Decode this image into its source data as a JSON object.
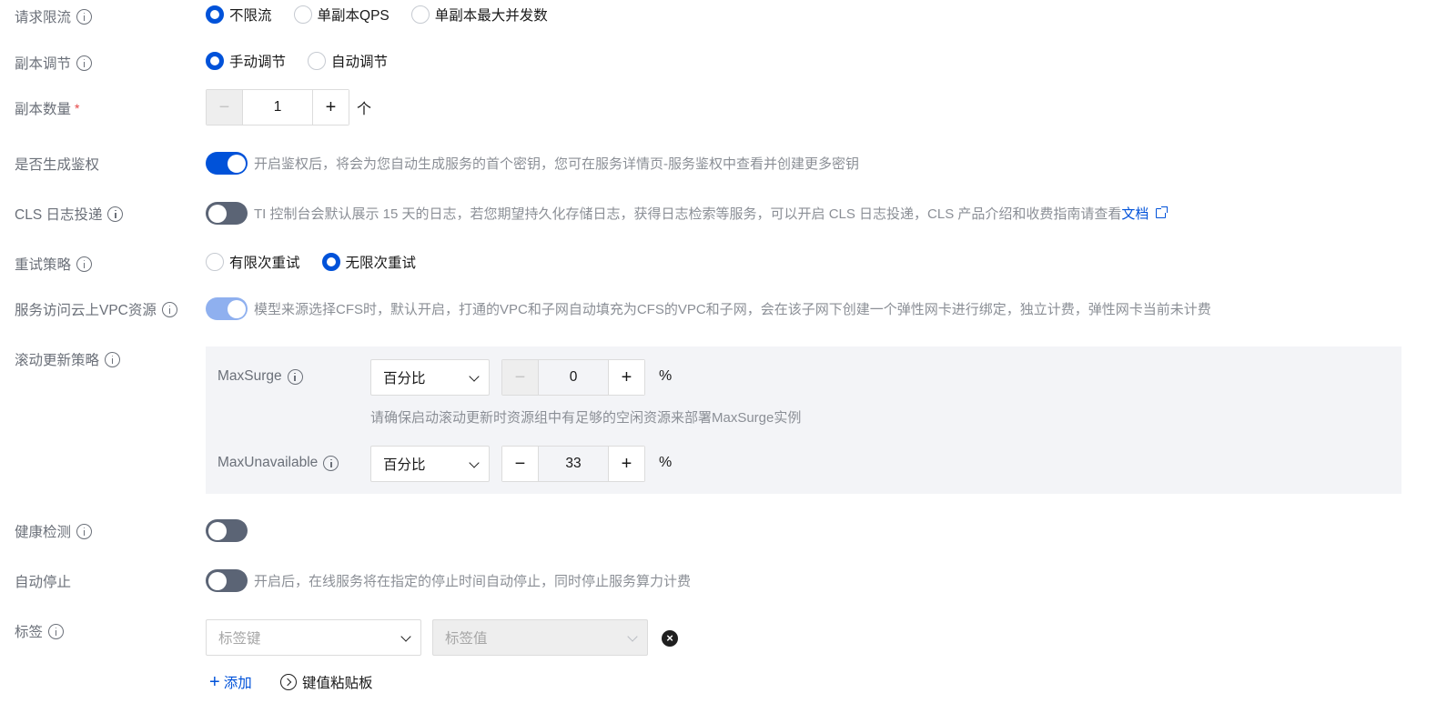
{
  "rate_limit": {
    "label": "请求限流",
    "options": [
      "不限流",
      "单副本QPS",
      "单副本最大并发数"
    ],
    "selected": "不限流"
  },
  "replica_adjust": {
    "label": "副本调节",
    "options": [
      "手动调节",
      "自动调节"
    ],
    "selected": "手动调节"
  },
  "replica_count": {
    "label": "副本数量",
    "required_mark": "*",
    "minus": "−",
    "value": "1",
    "plus": "+",
    "unit": "个"
  },
  "auth": {
    "label": "是否生成鉴权",
    "enabled": true,
    "hint": "开启鉴权后，将会为您自动生成服务的首个密钥，您可在服务详情页-服务鉴权中查看并创建更多密钥"
  },
  "cls": {
    "label": "CLS 日志投递",
    "enabled": false,
    "hint": "TI 控制台会默认展示 15 天的日志，若您期望持久化存储日志，获得日志检索等服务，可以开启 CLS 日志投递，CLS 产品介绍和收费指南请查看",
    "link": "文档"
  },
  "retry": {
    "label": "重试策略",
    "options": [
      "有限次重试",
      "无限次重试"
    ],
    "selected": "无限次重试"
  },
  "vpc": {
    "label": "服务访问云上VPC资源",
    "enabled": true,
    "disabled": true,
    "hint": "模型来源选择CFS时，默认开启，打通的VPC和子网自动填充为CFS的VPC和子网，会在该子网下创建一个弹性网卡进行绑定，独立计费，弹性网卡当前未计费"
  },
  "rolling_update": {
    "label": "滚动更新策略",
    "max_surge": {
      "label": "MaxSurge",
      "mode": "百分比",
      "minus": "−",
      "value": "0",
      "plus": "+",
      "unit": "%",
      "hint": "请确保启动滚动更新时资源组中有足够的空闲资源来部署MaxSurge实例"
    },
    "max_unavailable": {
      "label": "MaxUnavailable",
      "mode": "百分比",
      "minus": "−",
      "value": "33",
      "plus": "+",
      "unit": "%"
    }
  },
  "health_check": {
    "label": "健康检测",
    "enabled": false
  },
  "auto_stop": {
    "label": "自动停止",
    "enabled": false,
    "hint": "开启后，在线服务将在指定的停止时间自动停止，同时停止服务算力计费"
  },
  "tags": {
    "label": "标签",
    "key_placeholder": "标签键",
    "value_placeholder": "标签值",
    "add": "添加",
    "add_icon": "+",
    "paste": "键值粘贴板",
    "clear_icon": "×"
  },
  "colors": {
    "primary": "#0052d9",
    "switch_off": "#5b6475",
    "switch_on_disabled": "#8fb0ef",
    "panel_bg": "#f3f4f7"
  }
}
